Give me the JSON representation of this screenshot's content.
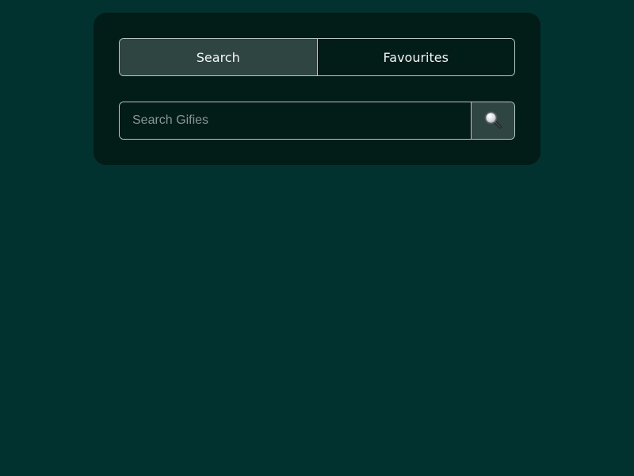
{
  "tabs": {
    "search_label": "Search",
    "favourites_label": "Favourites",
    "active": "search"
  },
  "search": {
    "placeholder": "Search Gifies",
    "value": "",
    "button_icon": "magnifying-glass-icon"
  },
  "colors": {
    "page_background": "#013230",
    "card_background": "#021c18",
    "active_tab": "#2e4542",
    "border": "#b9c5c2",
    "text": "#f2f6f5"
  }
}
